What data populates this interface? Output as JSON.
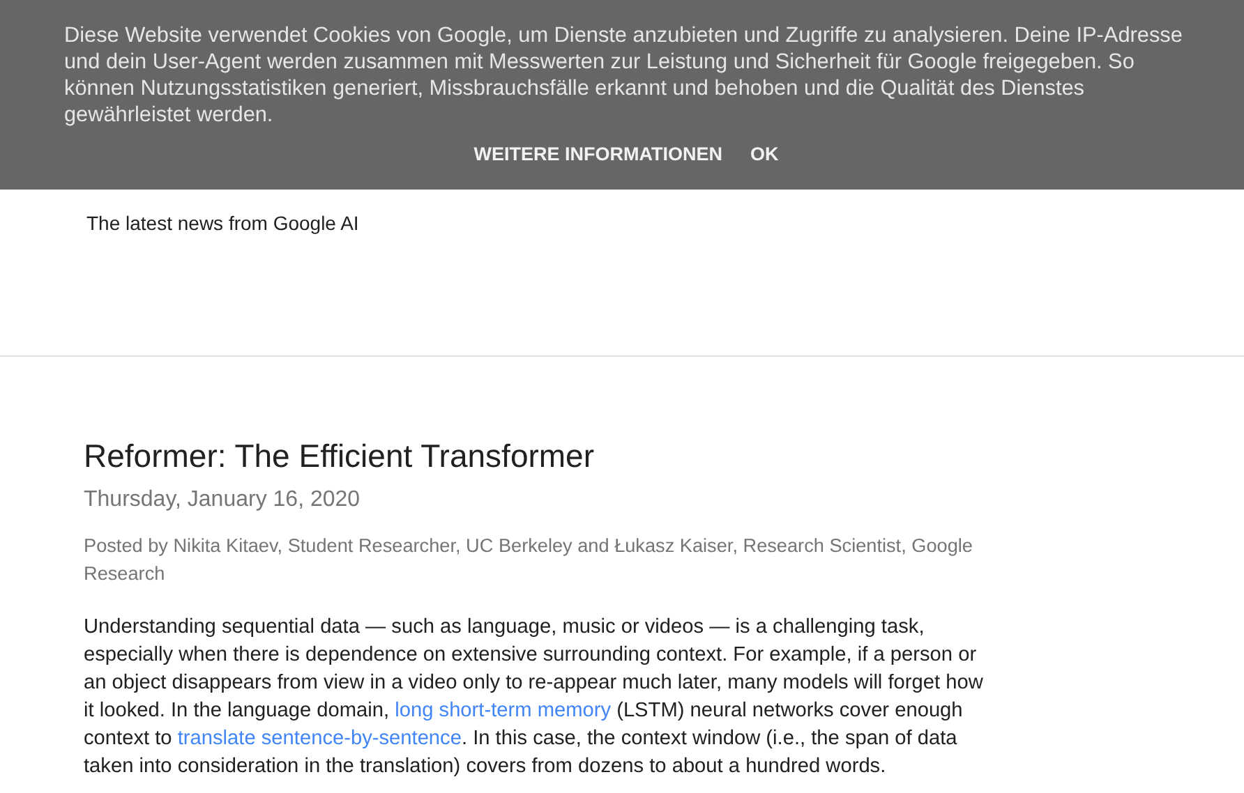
{
  "cookie_banner": {
    "message": "Diese Website verwendet Cookies von Google, um Dienste anzubieten und Zugriffe zu analysieren. Deine IP-Adresse und dein User-Agent werden zusammen mit Messwerten zur Leistung und Sicherheit für Google freigegeben. So können Nutzungsstatistiken generiert, Missbrauchsfälle erkannt und behoben und die Qualität des Dienstes gewährleistet werden.",
    "buttons": [
      "WEITERE INFORMATIONEN",
      "OK"
    ]
  },
  "header": {
    "description": "The latest news from Google AI"
  },
  "post": {
    "title": "Reformer: The Efficient Transformer",
    "date": "Thursday, January 16, 2020",
    "byline": "Posted by Nikita Kitaev, Student Researcher, UC Berkeley and Łukasz Kaiser, Research Scientist, Google Research",
    "paragraph": [
      {
        "kind": "text",
        "text": "Understanding sequential data — such as language, music or videos — is a challenging task, especially when there is dependence on extensive surrounding context. For example, if a person or an object disappears from view in a video only to re-appear much later, many models will forget how it looked. In the language domain, "
      },
      {
        "kind": "link",
        "text": "long short-term memory"
      },
      {
        "kind": "text",
        "text": " (LSTM) neural networks cover enough context to "
      },
      {
        "kind": "link",
        "text": "translate sentence-by-sentence"
      },
      {
        "kind": "text",
        "text": ". In this case, the context window (i.e., the span of data taken into consideration in the translation) covers from dozens to about a hundred words."
      }
    ]
  }
}
